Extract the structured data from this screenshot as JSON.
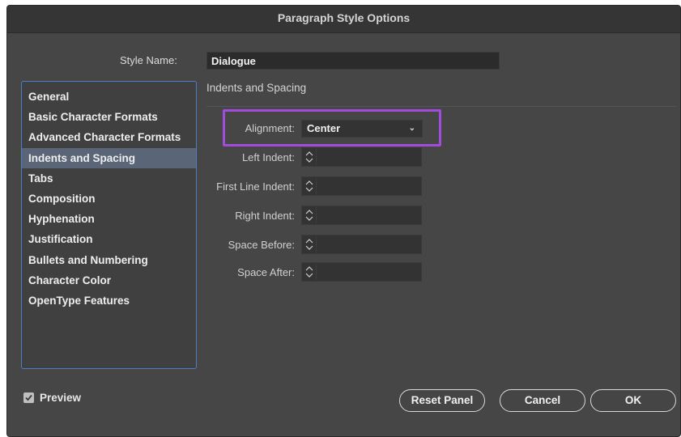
{
  "window": {
    "title": "Paragraph Style Options"
  },
  "style_name": {
    "label": "Style Name:",
    "value": "Dialogue"
  },
  "sidebar": {
    "items": [
      {
        "label": "General"
      },
      {
        "label": "Basic Character Formats"
      },
      {
        "label": "Advanced Character Formats"
      },
      {
        "label": "Indents and Spacing",
        "selected": true
      },
      {
        "label": "Tabs"
      },
      {
        "label": "Composition"
      },
      {
        "label": "Hyphenation"
      },
      {
        "label": "Justification"
      },
      {
        "label": "Bullets and Numbering"
      },
      {
        "label": "Character Color"
      },
      {
        "label": "OpenType Features"
      }
    ]
  },
  "panel": {
    "title": "Indents and Spacing",
    "alignment": {
      "label": "Alignment:",
      "value": "Center"
    },
    "left_indent": {
      "label": "Left Indent:",
      "value": ""
    },
    "first_line_indent": {
      "label": "First Line Indent:",
      "value": ""
    },
    "right_indent": {
      "label": "Right Indent:",
      "value": ""
    },
    "space_before": {
      "label": "Space Before:",
      "value": ""
    },
    "space_after": {
      "label": "Space After:",
      "value": ""
    }
  },
  "footer": {
    "preview": {
      "label": "Preview",
      "checked": true
    },
    "reset_label": "Reset Panel",
    "cancel_label": "Cancel",
    "ok_label": "OK"
  },
  "colors": {
    "highlight": "#a24cdd",
    "selection": "#5a6577",
    "sidebar_border": "#4a7fc8"
  }
}
